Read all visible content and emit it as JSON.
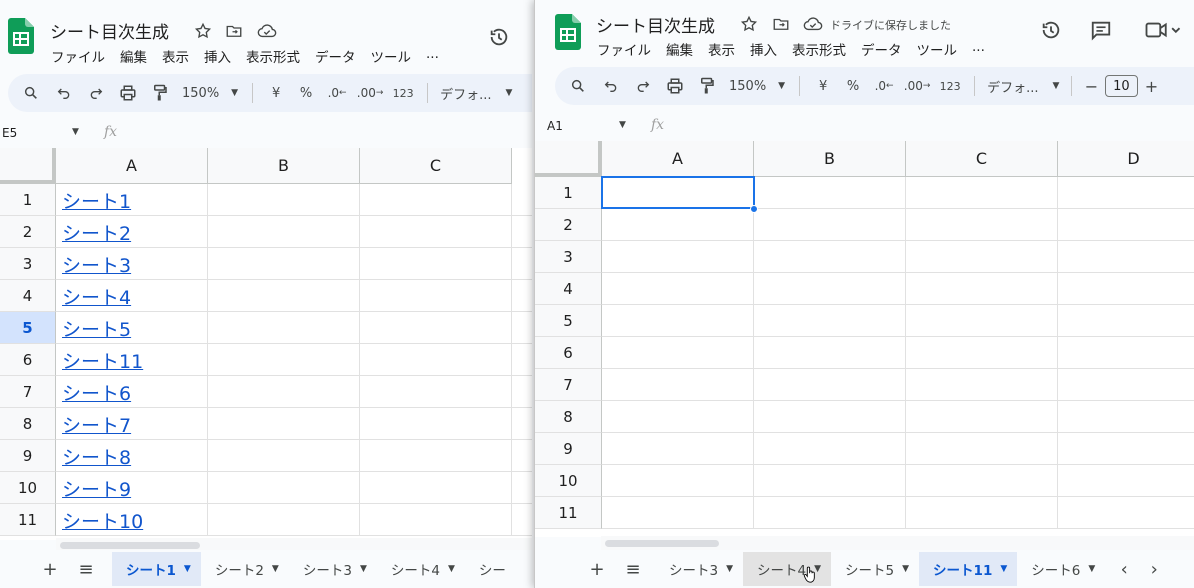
{
  "left": {
    "title": "シート目次生成",
    "menus": [
      "ファイル",
      "編集",
      "表示",
      "挿入",
      "表示形式",
      "データ",
      "ツール",
      "..."
    ],
    "toolbar": {
      "zoom": "150%",
      "currency": "¥",
      "percent": "%",
      "dec_minus": ".0",
      "dec_plus": ".00",
      "format123": "123",
      "font": "デフォ..."
    },
    "namebox": "E5",
    "fx": "fx",
    "columns": [
      "A",
      "B",
      "C"
    ],
    "rows": [
      "1",
      "2",
      "3",
      "4",
      "5",
      "6",
      "7",
      "8",
      "9",
      "10",
      "11"
    ],
    "selected_row": "5",
    "links": [
      "シート1",
      "シート2",
      "シート3",
      "シート4",
      "シート5",
      "シート11",
      "シート6",
      "シート7",
      "シート8",
      "シート9",
      "シート10"
    ],
    "tabs": [
      {
        "label": "シート1",
        "active": true
      },
      {
        "label": "シート2",
        "active": false
      },
      {
        "label": "シート3",
        "active": false
      },
      {
        "label": "シート4",
        "active": false
      },
      {
        "label": "シー",
        "active": false
      }
    ]
  },
  "right": {
    "title": "シート目次生成",
    "saved_status": "ドライブに保存しました",
    "menus": [
      "ファイル",
      "編集",
      "表示",
      "挿入",
      "表示形式",
      "データ",
      "ツール",
      "..."
    ],
    "toolbar": {
      "zoom": "150%",
      "currency": "¥",
      "percent": "%",
      "dec_minus": ".0",
      "dec_plus": ".00",
      "format123": "123",
      "font": "デフォ...",
      "font_size": "10",
      "minus": "−",
      "plus": "+"
    },
    "namebox": "A1",
    "fx": "fx",
    "columns": [
      "A",
      "B",
      "C",
      "D"
    ],
    "rows": [
      "1",
      "2",
      "3",
      "4",
      "5",
      "6",
      "7",
      "8",
      "9",
      "10",
      "11"
    ],
    "tabs": [
      {
        "label": "シート3",
        "active": false
      },
      {
        "label": "シート4",
        "active": false
      },
      {
        "label": "シート5",
        "active": false
      },
      {
        "label": "シート11",
        "active": true
      },
      {
        "label": "シート6",
        "active": false
      }
    ]
  },
  "colors": {
    "sheets_green": "#0f9d58",
    "accent_blue": "#0b57d0",
    "link_blue": "#1155cc",
    "toolbar_bg": "#edf2fa"
  },
  "icons": [
    "sheets-logo-icon",
    "star-icon",
    "folder-move-icon",
    "cloud-saved-icon",
    "history-icon",
    "comment-icon",
    "video-icon",
    "search-icon",
    "undo-icon",
    "redo-icon",
    "print-icon",
    "paint-format-icon",
    "add-sheet-icon",
    "all-sheets-icon"
  ]
}
